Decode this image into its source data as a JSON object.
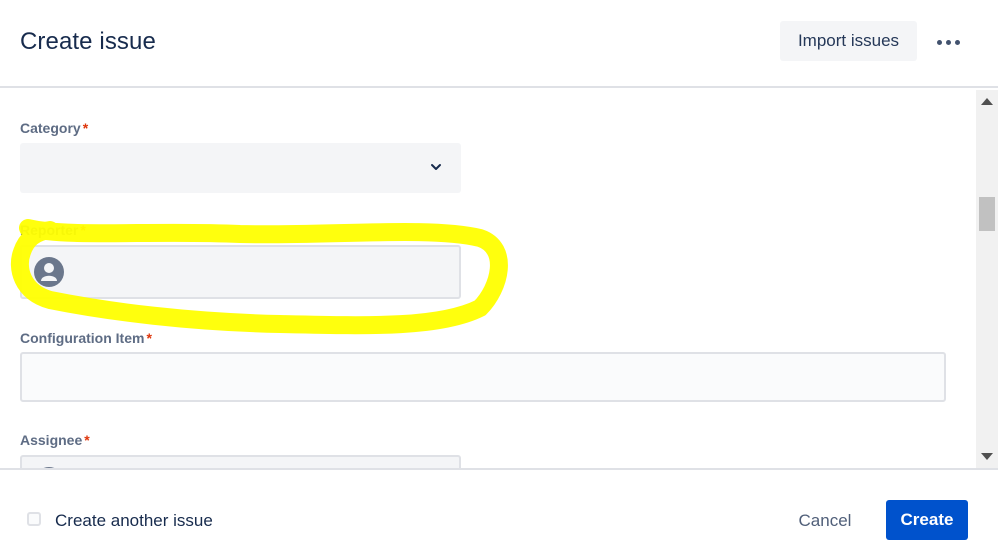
{
  "header": {
    "title": "Create issue",
    "import_label": "Import issues",
    "more_icon": "more-horizontal-icon"
  },
  "fields": {
    "category": {
      "label": "Category",
      "required_mark": "*",
      "value": ""
    },
    "reporter": {
      "label": "Reporter",
      "required_mark": "*",
      "value": ""
    },
    "configuration_item": {
      "label": "Configuration Item",
      "required_mark": "*",
      "value": ""
    },
    "assignee": {
      "label": "Assignee",
      "required_mark": "*",
      "value": ""
    }
  },
  "footer": {
    "create_another_label": "Create another issue",
    "create_another_checked": false,
    "cancel_label": "Cancel",
    "create_label": "Create"
  },
  "colors": {
    "primary": "#0052cc",
    "highlight": "#ffff00",
    "required": "#de350b"
  }
}
